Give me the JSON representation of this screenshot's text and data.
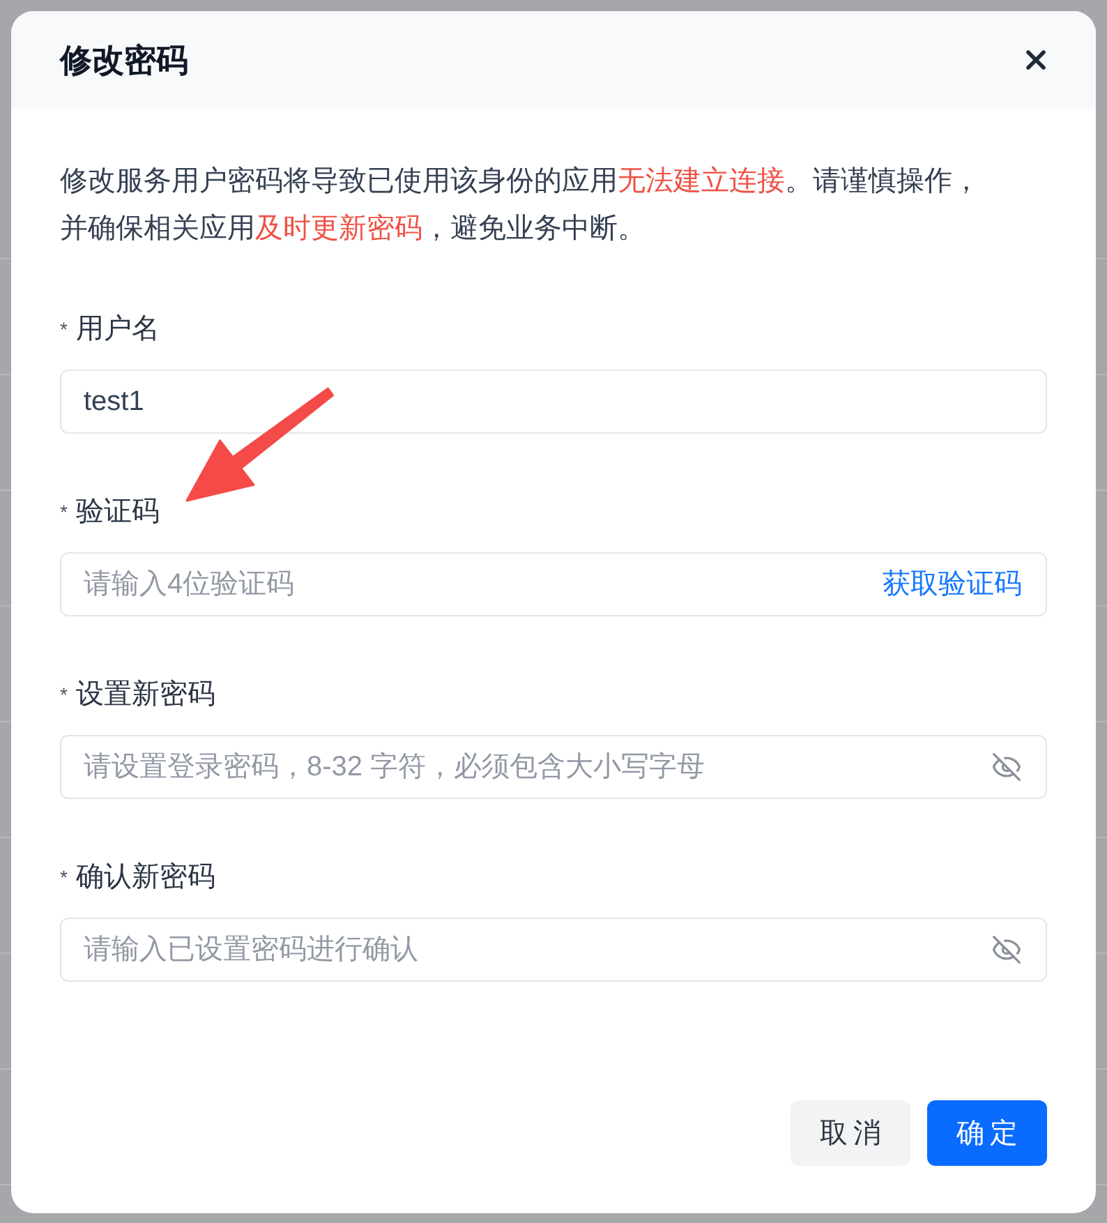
{
  "dialog": {
    "title": "修改密码"
  },
  "notice": [
    {
      "text": "修改服务用户密码将导致已使用该身份的应用",
      "highlight": false
    },
    {
      "text": "无法建立连接",
      "highlight": true
    },
    {
      "text": "。请谨慎操作，并确保相关应用",
      "highlight": false
    },
    {
      "text": "及时更新密码",
      "highlight": true
    },
    {
      "text": "，避免业务中断。",
      "highlight": false
    }
  ],
  "fields": [
    {
      "kind": "text",
      "required_mark": "*",
      "label": "用户名",
      "value": "test1"
    },
    {
      "kind": "code",
      "required_mark": "*",
      "label": "验证码",
      "placeholder": "请输入4位验证码",
      "action": "获取验证码"
    },
    {
      "kind": "password",
      "required_mark": "*",
      "label": "设置新密码",
      "placeholder": "请设置登录密码，8-32 字符，必须包含大小写字母"
    },
    {
      "kind": "password",
      "required_mark": "*",
      "label": "确认新密码",
      "placeholder": "请输入已设置密码进行确认"
    }
  ],
  "buttons": [
    {
      "kind": "secondary",
      "label": "取消"
    },
    {
      "kind": "primary",
      "label": "确定"
    }
  ]
}
